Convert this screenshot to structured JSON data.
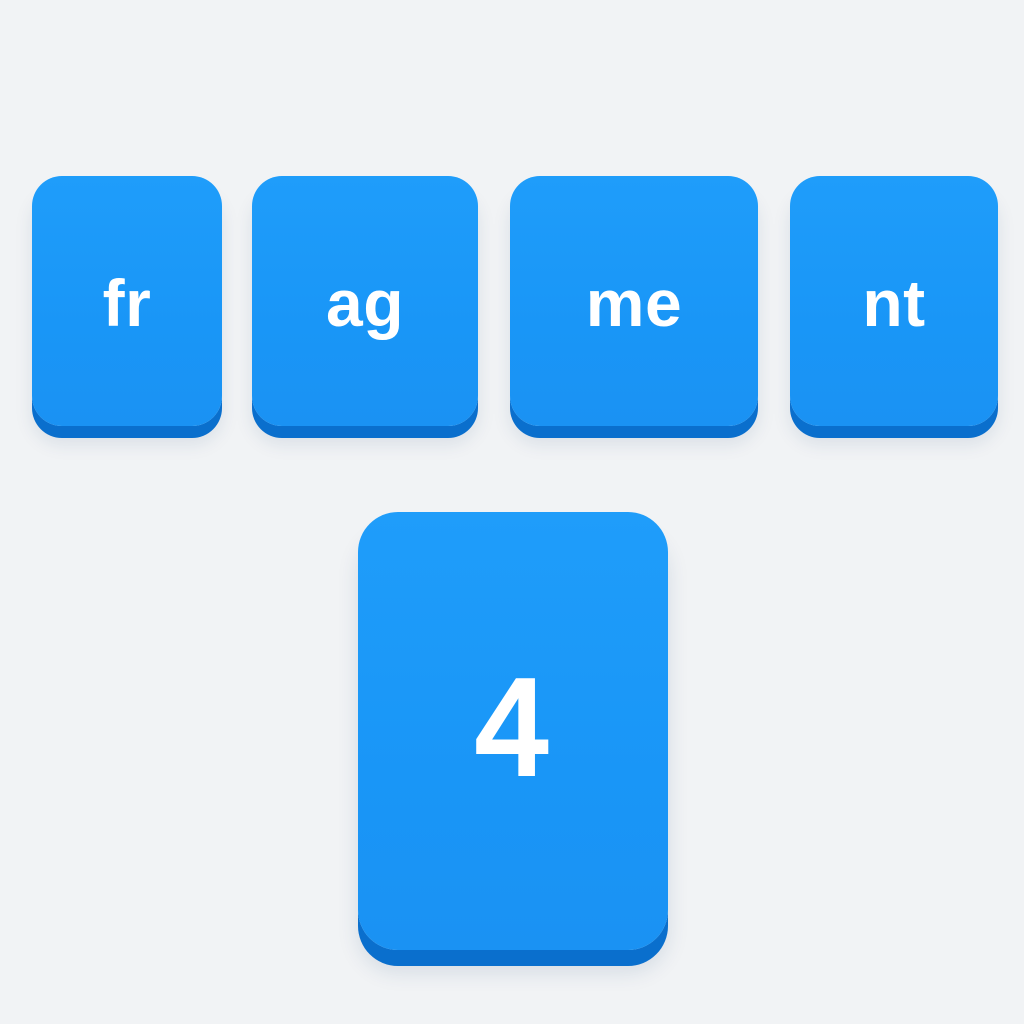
{
  "fragments": [
    {
      "text": "fr"
    },
    {
      "text": "ag"
    },
    {
      "text": "me"
    },
    {
      "text": "nt"
    }
  ],
  "count_tile": {
    "text": "4"
  },
  "colors": {
    "background": "#f1f3f5",
    "tile_face": "#1996f7",
    "tile_edge": "#0a6fcd",
    "tile_text": "#ffffff"
  }
}
